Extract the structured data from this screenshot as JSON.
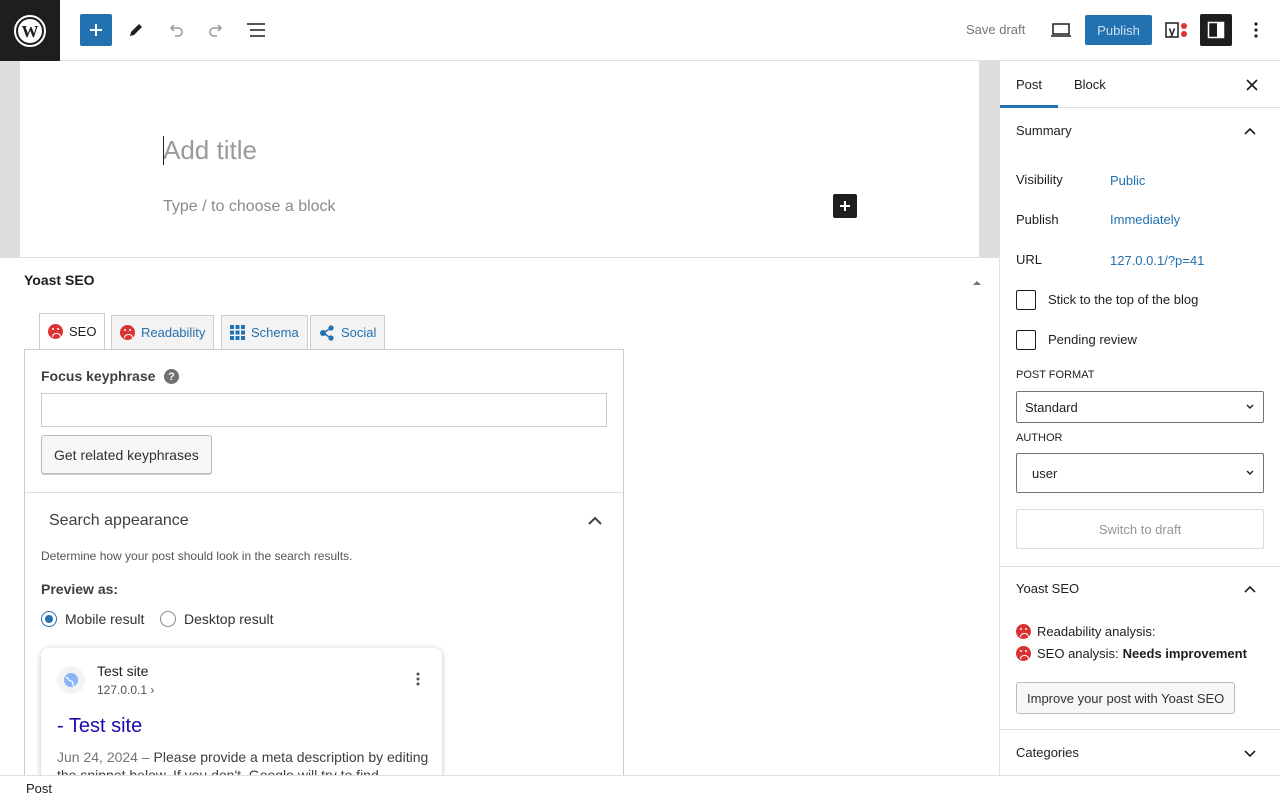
{
  "toolbar": {
    "save_draft": "Save draft",
    "publish": "Publish",
    "accent": "#2271b1"
  },
  "editor": {
    "title_placeholder": "Add title",
    "block_placeholder": "Type / to choose a block"
  },
  "yoast_metabox": {
    "title": "Yoast SEO",
    "tabs": [
      {
        "label": "SEO",
        "icon": "sad-face-icon"
      },
      {
        "label": "Readability",
        "icon": "sad-face-icon"
      },
      {
        "label": "Schema",
        "icon": "grid-icon"
      },
      {
        "label": "Social",
        "icon": "share-icon"
      }
    ],
    "focus_keyphrase_label": "Focus keyphrase",
    "focus_keyphrase_value": "",
    "related_button": "Get related keyphrases",
    "search_appearance": {
      "title": "Search appearance",
      "description": "Determine how your post should look in the search results.",
      "preview_as": "Preview as:",
      "options": [
        {
          "label": "Mobile result",
          "checked": true
        },
        {
          "label": "Desktop result",
          "checked": false
        }
      ]
    },
    "serp": {
      "site_name": "Test site",
      "url": "127.0.0.1 ›",
      "title": "- Test site",
      "date": "Jun 24, 2024",
      "separator": "–",
      "description": "Please provide a meta description by editing the snippet below. If you don't, Google will try to find"
    }
  },
  "sidebar": {
    "tabs": [
      "Post",
      "Block"
    ],
    "summary": {
      "title": "Summary",
      "visibility_label": "Visibility",
      "visibility_value": "Public",
      "publish_label": "Publish",
      "publish_value": "Immediately",
      "url_label": "URL",
      "url_value": "127.0.0.1/?p=41",
      "stick_label": "Stick to the top of the blog",
      "pending_label": "Pending review",
      "post_format_label": "POST FORMAT",
      "post_format_value": "Standard",
      "author_label": "AUTHOR",
      "author_value": "user",
      "switch_draft": "Switch to draft"
    },
    "yoast": {
      "title": "Yoast SEO",
      "readability_label": "Readability analysis:",
      "seo_label": "SEO analysis:",
      "seo_status": "Needs improvement",
      "improve_button": "Improve your post with Yoast SEO"
    },
    "categories_title": "Categories"
  },
  "footer": {
    "breadcrumb": "Post"
  }
}
